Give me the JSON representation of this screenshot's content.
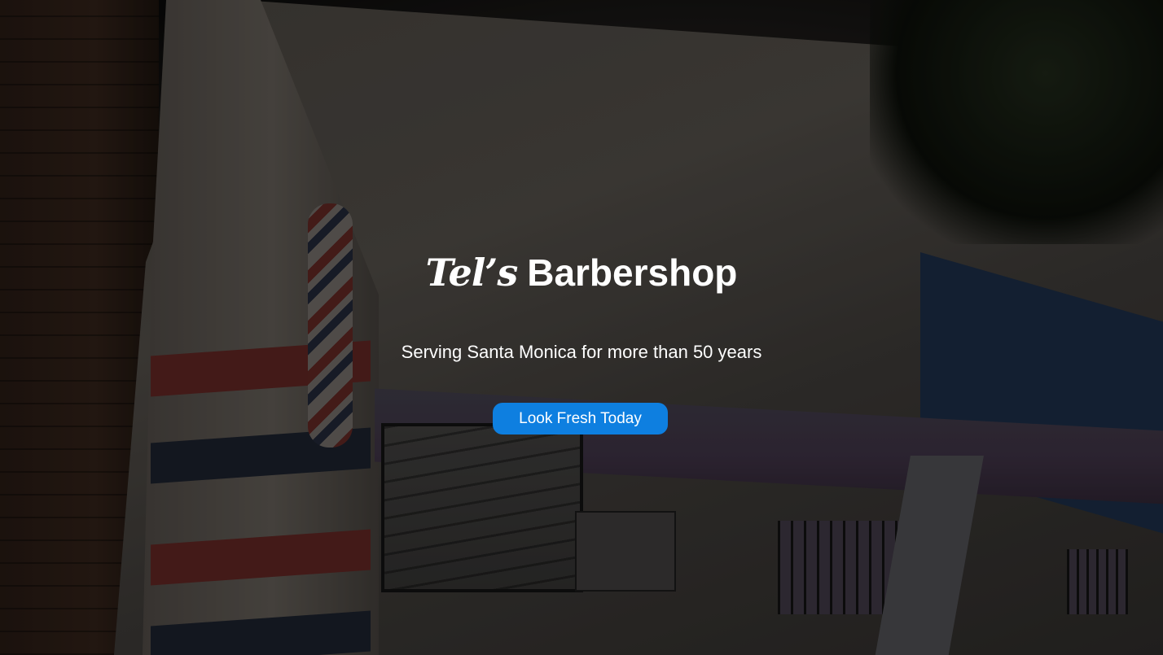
{
  "hero": {
    "brand_script": "Tel’s",
    "brand_word": "Barbershop",
    "tagline": "Serving Santa Monica for more than 50 years",
    "cta_label": "Look Fresh Today",
    "colors": {
      "cta_background": "#0e7fe0",
      "text": "#ffffff"
    }
  }
}
